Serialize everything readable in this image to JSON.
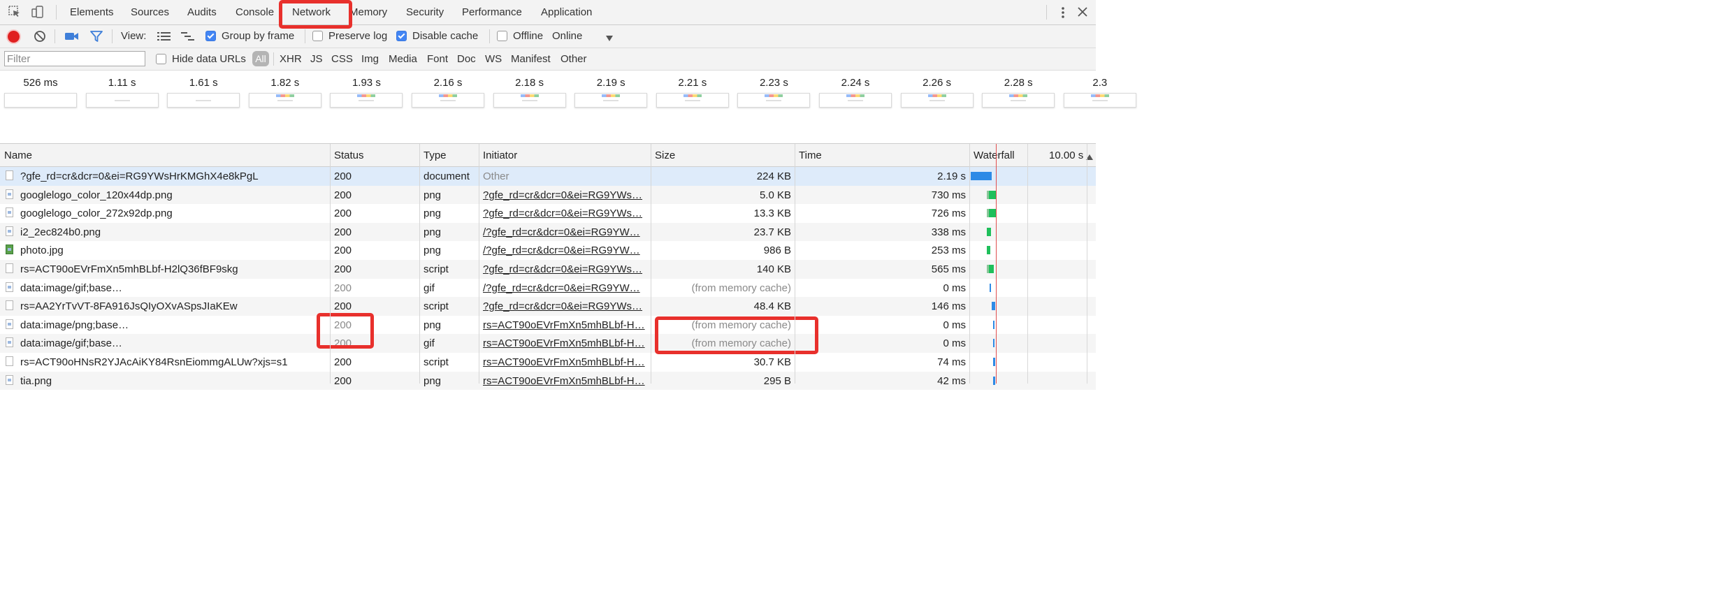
{
  "tabs": [
    "Elements",
    "Sources",
    "Audits",
    "Console",
    "Network",
    "Memory",
    "Security",
    "Performance",
    "Application"
  ],
  "toolbar": {
    "view_label": "View:",
    "group_by_frame": "Group by frame",
    "preserve_log": "Preserve log",
    "disable_cache": "Disable cache",
    "offline": "Offline",
    "throttle": "Online"
  },
  "filterbar": {
    "placeholder": "Filter",
    "hide_data_urls": "Hide data URLs",
    "types": [
      "All",
      "XHR",
      "JS",
      "CSS",
      "Img",
      "Media",
      "Font",
      "Doc",
      "WS",
      "Manifest",
      "Other"
    ]
  },
  "filmstrip": [
    "526 ms",
    "1.11 s",
    "1.61 s",
    "1.82 s",
    "1.93 s",
    "2.16 s",
    "2.18 s",
    "2.19 s",
    "2.21 s",
    "2.23 s",
    "2.24 s",
    "2.26 s",
    "2.28 s",
    "2.3"
  ],
  "columns": {
    "name": "Name",
    "status": "Status",
    "type": "Type",
    "initiator": "Initiator",
    "size": "Size",
    "time": "Time",
    "waterfall": "Waterfall",
    "waterfall_scale": "10.00 s"
  },
  "rows": [
    {
      "name": "?gfe_rd=cr&dcr=0&ei=RG9YWsHrKMGhX4e8kPgL",
      "status": "200",
      "type": "document",
      "initiator": "Other",
      "size": "224 KB",
      "time": "2.19 s"
    },
    {
      "name": "googlelogo_color_120x44dp.png",
      "status": "200",
      "type": "png",
      "initiator": "?gfe_rd=cr&dcr=0&ei=RG9YWs…",
      "size": "5.0 KB",
      "time": "730 ms"
    },
    {
      "name": "googlelogo_color_272x92dp.png",
      "status": "200",
      "type": "png",
      "initiator": "?gfe_rd=cr&dcr=0&ei=RG9YWs…",
      "size": "13.3 KB",
      "time": "726 ms"
    },
    {
      "name": "i2_2ec824b0.png",
      "status": "200",
      "type": "png",
      "initiator": "/?gfe_rd=cr&dcr=0&ei=RG9YW…",
      "size": "23.7 KB",
      "time": "338 ms"
    },
    {
      "name": "photo.jpg",
      "status": "200",
      "type": "png",
      "initiator": "/?gfe_rd=cr&dcr=0&ei=RG9YW…",
      "size": "986 B",
      "time": "253 ms"
    },
    {
      "name": "rs=ACT90oEVrFmXn5mhBLbf-H2lQ36fBF9skg",
      "status": "200",
      "type": "script",
      "initiator": "?gfe_rd=cr&dcr=0&ei=RG9YWs…",
      "size": "140 KB",
      "time": "565 ms"
    },
    {
      "name": "data:image/gif;base…",
      "status": "200",
      "type": "gif",
      "initiator": "/?gfe_rd=cr&dcr=0&ei=RG9YW…",
      "size": "(from memory cache)",
      "time": "0 ms"
    },
    {
      "name": "rs=AA2YrTvVT-8FA916JsQIyOXvASpsJIaKEw",
      "status": "200",
      "type": "script",
      "initiator": "?gfe_rd=cr&dcr=0&ei=RG9YWs…",
      "size": "48.4 KB",
      "time": "146 ms"
    },
    {
      "name": "data:image/png;base…",
      "status": "200",
      "type": "png",
      "initiator": "rs=ACT90oEVrFmXn5mhBLbf-H…",
      "size": "(from memory cache)",
      "time": "0 ms"
    },
    {
      "name": "data:image/gif;base…",
      "status": "200",
      "type": "gif",
      "initiator": "rs=ACT90oEVrFmXn5mhBLbf-H…",
      "size": "(from memory cache)",
      "time": "0 ms"
    },
    {
      "name": "rs=ACT90oHNsR2YJAcAiKY84RsnEiommgALUw?xjs=s1",
      "status": "200",
      "type": "script",
      "initiator": "rs=ACT90oEVrFmXn5mhBLbf-H…",
      "size": "30.7 KB",
      "time": "74 ms"
    },
    {
      "name": "tia.png",
      "status": "200",
      "type": "png",
      "initiator": "rs=ACT90oEVrFmXn5mhBLbf-H…",
      "size": "295 B",
      "time": "42 ms"
    }
  ]
}
